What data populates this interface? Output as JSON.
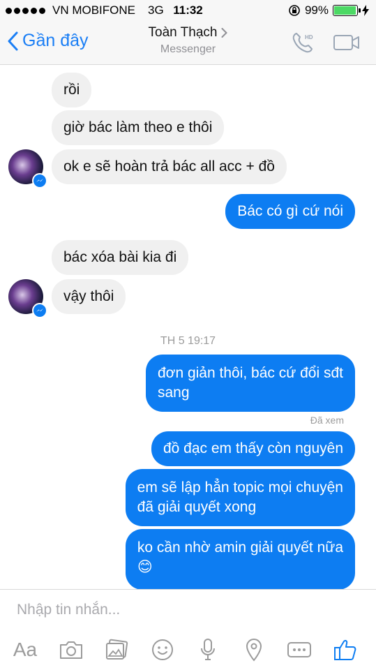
{
  "status_bar": {
    "carrier": "VN MOBIFONE",
    "network": "3G",
    "time": "11:32",
    "battery": "99%"
  },
  "nav": {
    "back_label": "Gần đây",
    "contact_name": "Toàn Thạch",
    "app_name": "Messenger"
  },
  "messages": [
    {
      "side": "in",
      "text": "rồi"
    },
    {
      "side": "in",
      "text": "giờ bác làm theo e thôi"
    },
    {
      "side": "in",
      "text": "ok e sẽ hoàn trả bác all acc + đồ"
    },
    {
      "side": "out",
      "text": "Bác có gì cứ nói"
    },
    {
      "side": "in",
      "text": "bác xóa bài kia đi"
    },
    {
      "side": "in",
      "text": "vậy thôi"
    },
    {
      "side": "out",
      "text_line1": "đơn giản thôi, bác cứ đổi sđt",
      "text_line2": "sang"
    },
    {
      "side": "out",
      "text": "đồ đạc em thấy còn nguyên"
    },
    {
      "side": "out",
      "text_line1": "em sẽ lập hẳn topic mọi chuyện",
      "text_line2": "đã giải quyết xong"
    },
    {
      "side": "out",
      "text_line1": "ko cần nhờ amin giải quyết nữa",
      "text_line2": "😊"
    }
  ],
  "timestamp": "TH 5 19:17",
  "seen_label": "Đã xem",
  "composer": {
    "placeholder": "Nhập tin nhắn...",
    "aa_label": "Aa"
  },
  "icons": [
    "hd-call-icon",
    "video-call-icon",
    "camera-icon",
    "gallery-icon",
    "emoji-icon",
    "microphone-icon",
    "location-icon",
    "more-icon",
    "like-icon"
  ],
  "colors": {
    "accent": "#0d7df2",
    "incoming": "#f0f0f0",
    "battery": "#4cd964"
  }
}
